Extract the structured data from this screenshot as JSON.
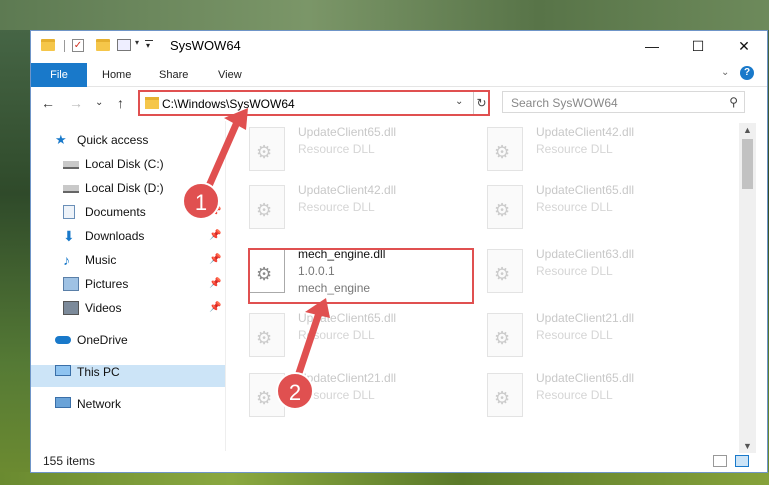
{
  "window": {
    "title": "SysWOW64"
  },
  "titlebar": {
    "minimize": "—",
    "maximize": "☐",
    "close": "✕"
  },
  "ribbon": {
    "file": "File",
    "tabs": [
      "Home",
      "Share",
      "View"
    ],
    "expand": "⌄",
    "help": "?"
  },
  "nav": {
    "back": "←",
    "forward": "→",
    "recent": "⌄",
    "up": "↑"
  },
  "address": {
    "path": "C:\\Windows\\SysWOW64",
    "dropdown": "⌄",
    "refresh": "↻"
  },
  "search": {
    "placeholder": "Search SysWOW64",
    "icon": "⚲"
  },
  "sidebar": {
    "items": [
      {
        "label": "Quick access",
        "icon": "star-icon",
        "pinned": false
      },
      {
        "label": "Local Disk (C:)",
        "icon": "drive-icon",
        "pinned": true
      },
      {
        "label": "Local Disk (D:)",
        "icon": "drive-icon",
        "pinned": true
      },
      {
        "label": "Documents",
        "icon": "documents-icon",
        "pinned": true
      },
      {
        "label": "Downloads",
        "icon": "download-icon",
        "pinned": true
      },
      {
        "label": "Music",
        "icon": "music-icon",
        "pinned": true
      },
      {
        "label": "Pictures",
        "icon": "pictures-icon",
        "pinned": true
      },
      {
        "label": "Videos",
        "icon": "videos-icon",
        "pinned": true
      },
      {
        "label": "OneDrive",
        "icon": "cloud-icon",
        "pinned": false
      },
      {
        "label": "This PC",
        "icon": "pc-icon",
        "pinned": false,
        "selected": true
      },
      {
        "label": "Network",
        "icon": "network-icon",
        "pinned": false
      }
    ]
  },
  "files": [
    {
      "name": "UpdateClient65.dll",
      "type": "Resource DLL"
    },
    {
      "name": "UpdateClient42.dll",
      "type": "Resource DLL"
    },
    {
      "name": "UpdateClient42.dll",
      "type": "Resource DLL"
    },
    {
      "name": "UpdateClient65.dll",
      "type": "Resource DLL"
    },
    {
      "name": "mech_engine.dll",
      "type": "1.0.0.1",
      "extra": "mech_engine",
      "active": true
    },
    {
      "name": "UpdateClient63.dll",
      "type": "Resource DLL"
    },
    {
      "name": "UpdateClient65.dll",
      "type": "Resource DLL"
    },
    {
      "name": "UpdateClient21.dll",
      "type": "Resource DLL"
    },
    {
      "name": "UpdateClient21.dll",
      "type": "Resource DLL"
    },
    {
      "name": "UpdateClient65.dll",
      "type": "Resource DLL"
    }
  ],
  "status": {
    "count": "155 items"
  },
  "callouts": [
    "1",
    "2"
  ],
  "colors": {
    "accent": "#1979ca",
    "highlight": "#e05050",
    "selection": "#cce4f7"
  }
}
